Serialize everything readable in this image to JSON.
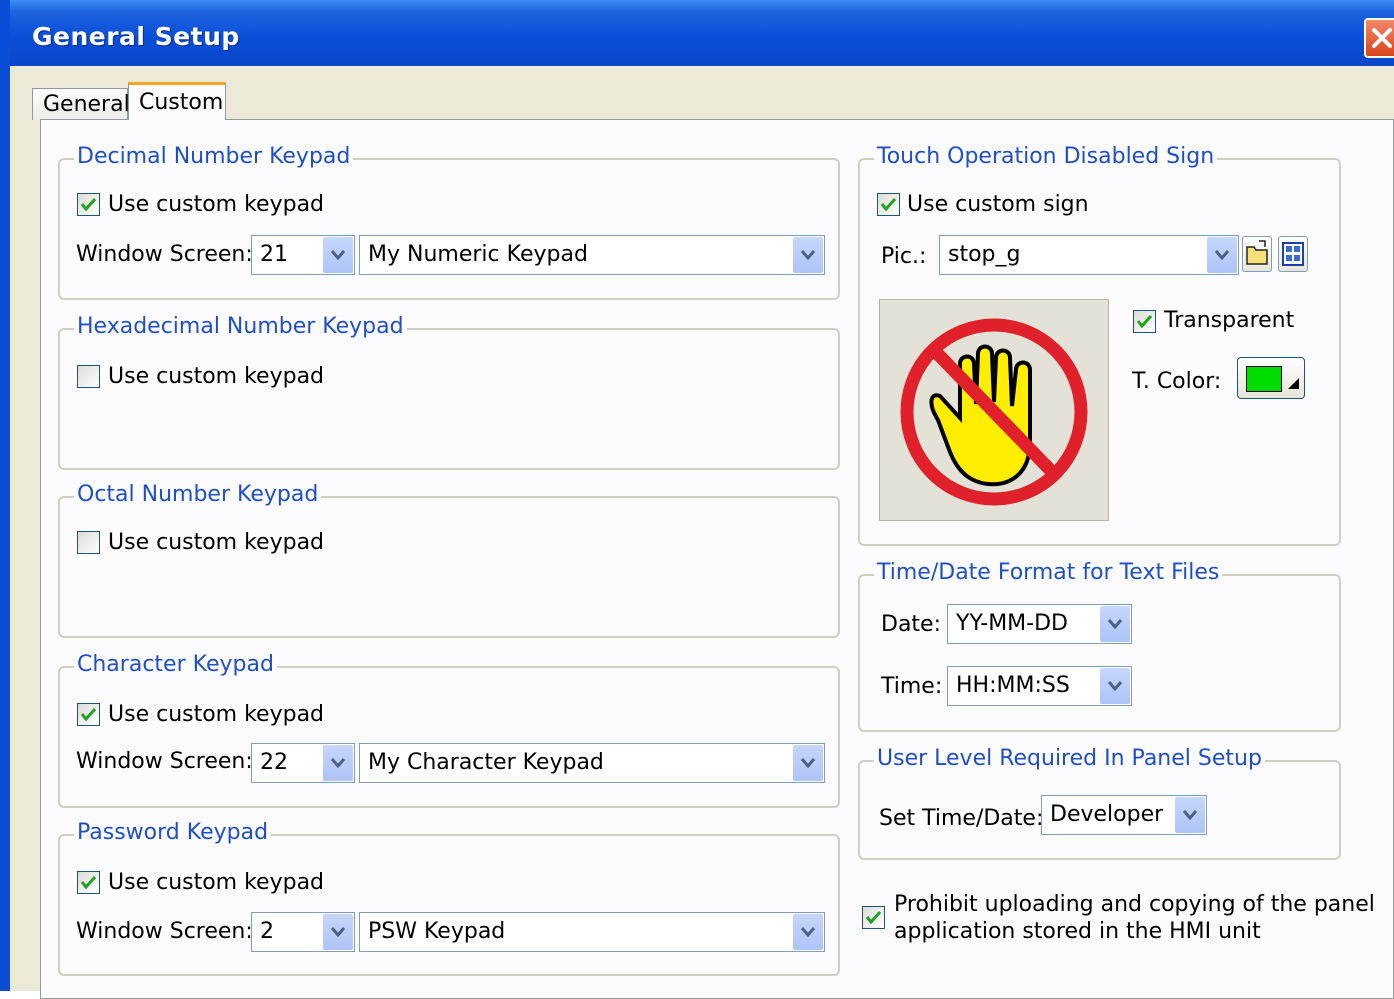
{
  "window": {
    "title": "General Setup"
  },
  "tabs": [
    {
      "label": "General"
    },
    {
      "label": "Custom"
    }
  ],
  "decimal": {
    "title": "Decimal Number Keypad",
    "use_label": "Use custom keypad",
    "use_checked": true,
    "window_screen_label": "Window Screen:",
    "screen_no": "21",
    "screen_name": "My Numeric Keypad"
  },
  "hex": {
    "title": "Hexadecimal Number Keypad",
    "use_label": "Use custom keypad",
    "use_checked": false
  },
  "octal": {
    "title": "Octal Number Keypad",
    "use_label": "Use custom keypad",
    "use_checked": false
  },
  "character": {
    "title": "Character Keypad",
    "use_label": "Use custom keypad",
    "use_checked": true,
    "window_screen_label": "Window Screen:",
    "screen_no": "22",
    "screen_name": "My Character Keypad"
  },
  "password": {
    "title": "Password Keypad",
    "use_label": "Use custom keypad",
    "use_checked": true,
    "window_screen_label": "Window Screen:",
    "screen_no": "2",
    "screen_name": "PSW Keypad"
  },
  "touch": {
    "title": "Touch Operation Disabled Sign",
    "use_label": "Use custom sign",
    "use_checked": true,
    "pic_label": "Pic.:",
    "pic_value": "stop_g",
    "transparent_label": "Transparent",
    "transparent_checked": true,
    "tcolor_label": "T. Color:",
    "tcolor": "#00dd00"
  },
  "timedate": {
    "title": "Time/Date Format for Text Files",
    "date_label": "Date:",
    "date_value": "YY-MM-DD",
    "time_label": "Time:",
    "time_value": "HH:MM:SS"
  },
  "userlevel": {
    "title": "User Level Required In Panel Setup",
    "set_label": "Set Time/Date:",
    "set_value": "Developer"
  },
  "prohibit": {
    "line1": "Prohibit uploading and copying of the panel",
    "line2": "application stored in the HMI unit",
    "checked": true
  },
  "icons": {
    "close": "close-icon",
    "folder": "folder-icon",
    "grid": "grid-icon",
    "stop_sign": "stop-hand-icon",
    "dropdown": "chevron-down-icon"
  },
  "colors": {
    "title_bar": "#0b4fd8",
    "group_title": "#1f4fc4",
    "accent_tab": "#f5a623"
  }
}
